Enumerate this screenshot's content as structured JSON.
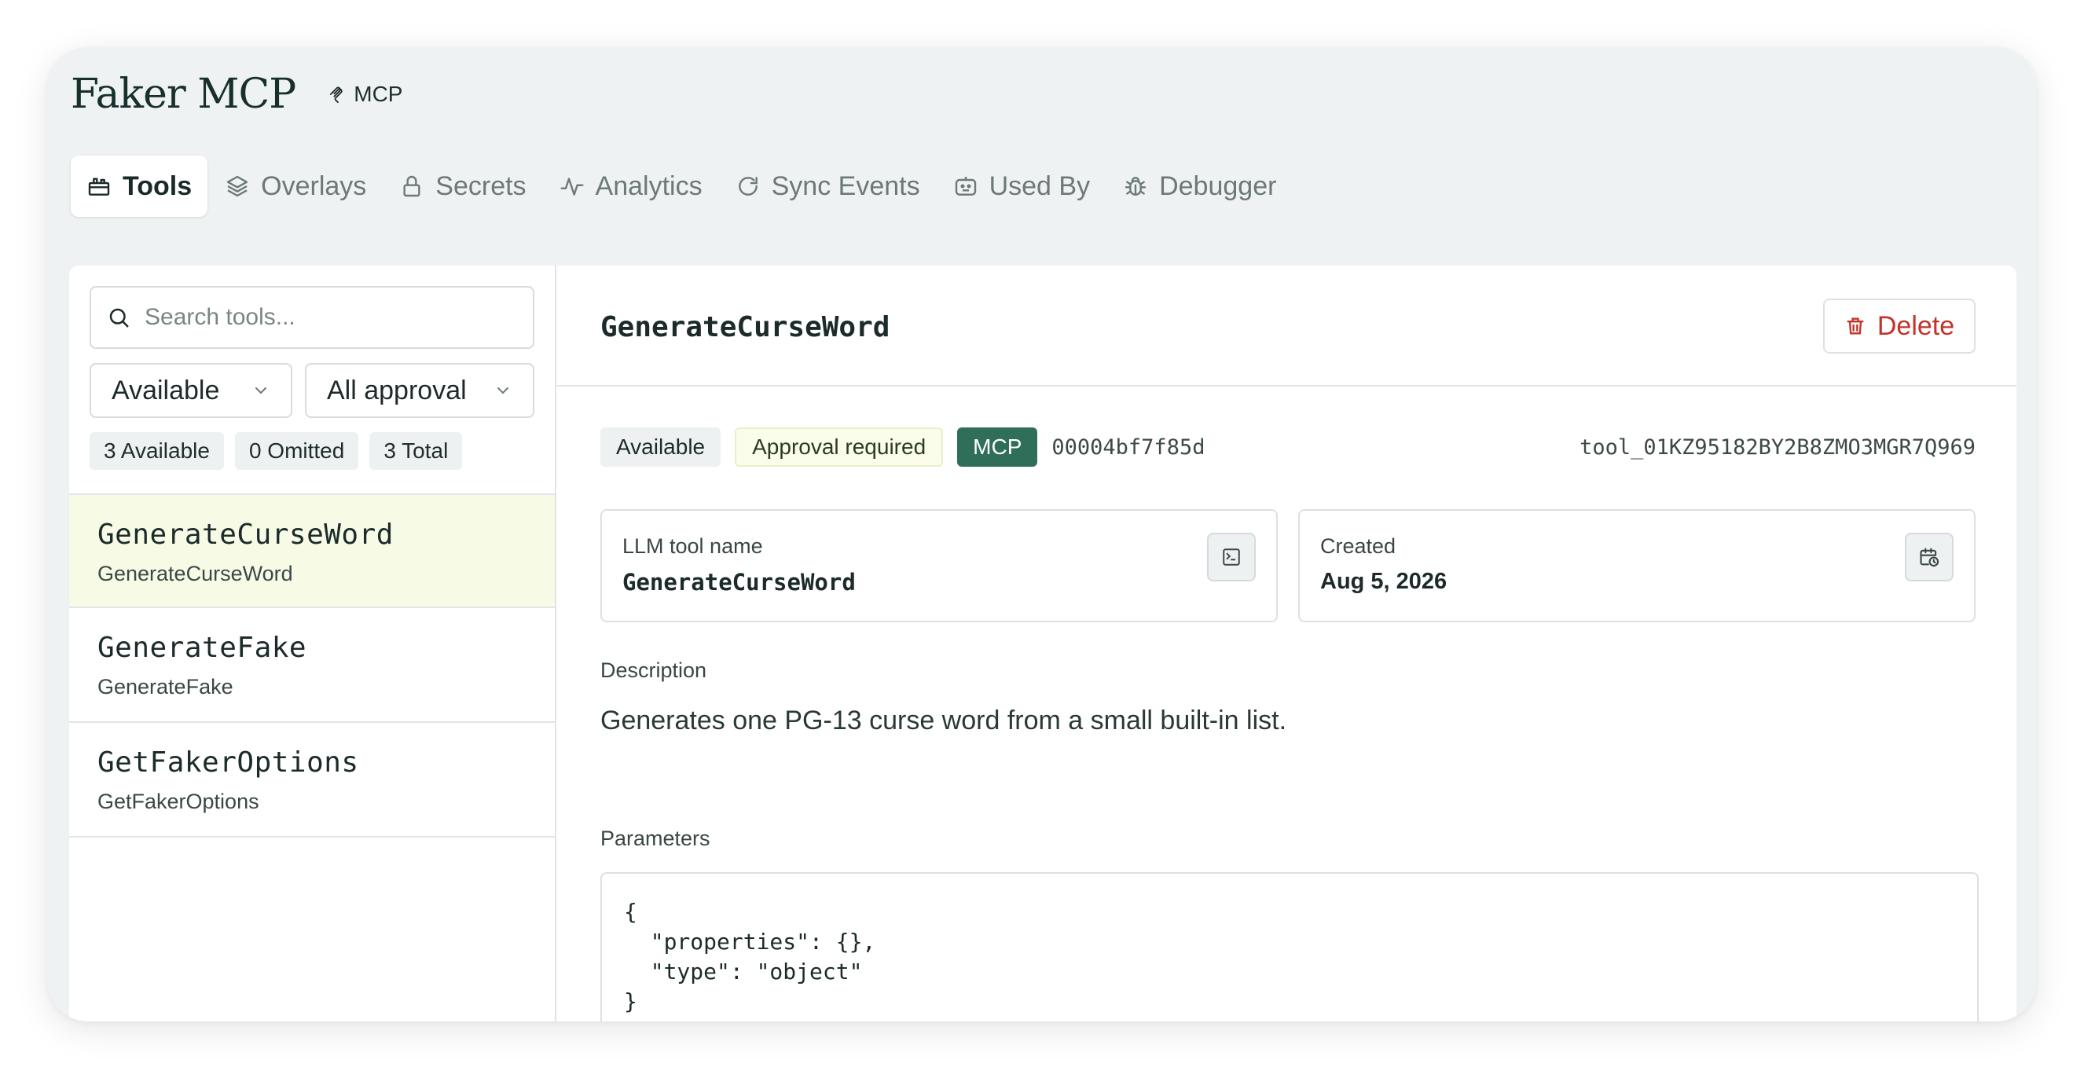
{
  "header": {
    "title": "Faker MCP",
    "type_tag": "MCP"
  },
  "tabs": [
    {
      "label": "Tools",
      "icon": "toolbox-icon",
      "active": true
    },
    {
      "label": "Overlays",
      "icon": "layers-icon",
      "active": false
    },
    {
      "label": "Secrets",
      "icon": "lock-icon",
      "active": false
    },
    {
      "label": "Analytics",
      "icon": "activity-icon",
      "active": false
    },
    {
      "label": "Sync Events",
      "icon": "refresh-icon",
      "active": false
    },
    {
      "label": "Used By",
      "icon": "bot-icon",
      "active": false
    },
    {
      "label": "Debugger",
      "icon": "bug-icon",
      "active": false
    }
  ],
  "sidebar": {
    "search_placeholder": "Search tools...",
    "filter_status": "Available",
    "filter_approval": "All approval",
    "counts": [
      "3 Available",
      "0 Omitted",
      "3 Total"
    ],
    "tools": [
      {
        "name": "GenerateCurseWord",
        "subtitle": "GenerateCurseWord",
        "selected": true
      },
      {
        "name": "GenerateFake",
        "subtitle": "GenerateFake",
        "selected": false
      },
      {
        "name": "GetFakerOptions",
        "subtitle": "GetFakerOptions",
        "selected": false
      }
    ]
  },
  "detail": {
    "title": "GenerateCurseWord",
    "delete_label": "Delete",
    "badges": {
      "available": "Available",
      "approval": "Approval required",
      "type": "MCP"
    },
    "hash": "00004bf7f85d",
    "tool_id": "tool_01KZ95182BY2B8ZMO3MGR7Q969",
    "llm_tool_name_label": "LLM tool name",
    "llm_tool_name": "GenerateCurseWord",
    "created_label": "Created",
    "created_value": "Aug 5, 2026",
    "description_label": "Description",
    "description": "Generates one PG-13 curse word from a small built-in list.",
    "parameters_label": "Parameters",
    "parameters": "{\n  \"properties\": {},\n  \"type\": \"object\"\n}"
  },
  "colors": {
    "accent_green": "#2f6e58",
    "danger": "#c4322b",
    "selected_row": "#f7fbe6",
    "window_bg": "#eff2f3"
  }
}
